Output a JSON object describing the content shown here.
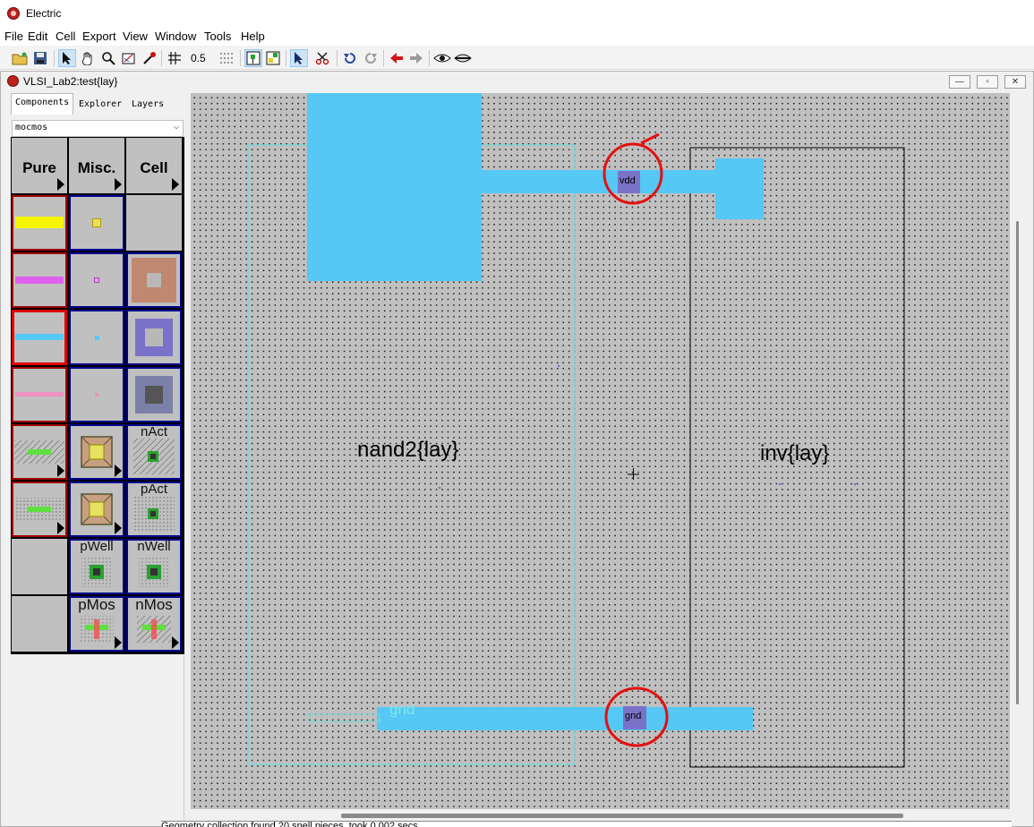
{
  "app": {
    "title": "Electric"
  },
  "menu": [
    "File",
    "Edit",
    "Cell",
    "Export",
    "View",
    "Window",
    "Tools",
    "Help"
  ],
  "toolbar": {
    "grid_value": "0.5"
  },
  "document": {
    "title": "VLSI_Lab2:test{lay}",
    "minimize": "—",
    "restore": "▫",
    "close": "✕"
  },
  "side_panel": {
    "tabs": [
      "Components",
      "Explorer",
      "Layers"
    ],
    "technology": "mocmos",
    "headers": [
      "Pure",
      "Misc.",
      "Cell"
    ],
    "cell_labels": {
      "nact": "nAct",
      "pact": "pAct",
      "pwell": "pWell",
      "nwell": "nWell",
      "pmos": "pMos",
      "nmos": "nMos"
    }
  },
  "canvas": {
    "instance_nand": "nand2{lay}",
    "instance_inv": "inv{lay}",
    "export_vdd": "vdd",
    "export_gnd": "gnd",
    "wire_label_gnd": "gnd"
  },
  "status": {
    "text": "Geometry collection found 20 spell pieces, took 0.002 secs"
  },
  "colors": {
    "metal1": "#55c8f5",
    "contact": "#7a72c8",
    "annotation": "#e41010",
    "cell_outline_nand": "#7fd4d4"
  }
}
